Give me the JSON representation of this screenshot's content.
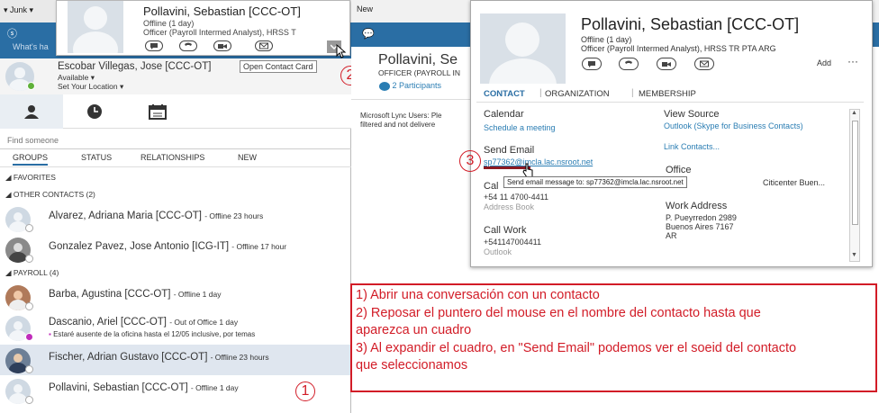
{
  "top_left": {
    "junk_label": "Junk",
    "new_label": "New",
    "whats_label": "What's ha"
  },
  "me": {
    "name": "Escobar Villegas, Jose [CCC-OT]",
    "availability": "Available",
    "location": "Set Your Location",
    "tooltip": "Open Contact Card"
  },
  "search": {
    "placeholder": "Find someone"
  },
  "group_tabs": [
    "GROUPS",
    "STATUS",
    "RELATIONSHIPS",
    "NEW"
  ],
  "sections": {
    "favorites": "FAVORITES",
    "other": "OTHER CONTACTS (2)",
    "payroll": "PAYROLL (4)"
  },
  "contacts": [
    {
      "name": "Alvarez, Adriana Maria [CCC-OT]",
      "status": "- Offline 23 hours"
    },
    {
      "name": "Gonzalez Pavez, Jose Antonio [ICG-IT]",
      "status": "- Offline 17 hour"
    },
    {
      "name": "Barba, Agustina [CCC-OT]",
      "status": "- Offline 1 day"
    },
    {
      "name": "Dascanio, Ariel [CCC-OT]",
      "status": "- Out of Office 1 day",
      "note": "Estaré ausente de la oficina hasta el  12/05  inclusive, por temas"
    },
    {
      "name": "Fischer, Adrian Gustavo [CCC-OT]",
      "status": "- Offline 23 hours"
    },
    {
      "name": "Pollavini, Sebastian [CCC-OT]",
      "status": "- Offline 1 day"
    }
  ],
  "card_small": {
    "name": "Pollavini, Sebastian [CCC-OT]",
    "status": "Offline (1 day)",
    "title": "Officer (Payroll Intermed Analyst), HRSS T"
  },
  "conversation": {
    "name": "Pollavini, Se",
    "title": "OFFICER (PAYROLL IN",
    "participants": "2 Participants",
    "message1": "Microsoft Lync Users: Ple",
    "message2": "filtered and not delivere"
  },
  "card_big": {
    "name": "Pollavini, Sebastian [CCC-OT]",
    "status": "Offline (1 day)",
    "title": "Officer (Payroll Intermed Analyst), HRSS TR PTA ARG",
    "add_label": "Add",
    "tabs": [
      "CONTACT",
      "ORGANIZATION",
      "MEMBERSHIP"
    ],
    "calendar_label": "Calendar",
    "schedule_link": "Schedule a meeting",
    "view_source_label": "View Source",
    "view_source_value": "Outlook (Skype for Business Contacts)",
    "link_contacts": "Link Contacts...",
    "send_email_label": "Send Email",
    "email": "sp77362@imcla.lac.nsroot.net",
    "email_tooltip": "Send email message to: sp77362@imcla.lac.nsroot.net",
    "office_label": "Office",
    "office_value": "Citicenter Buen...",
    "call_label": "Cal",
    "call_number": "+54 11 4700-4411",
    "call_source": "Address Book",
    "work_address_label": "Work Address",
    "work_address_lines": [
      "P. Pueyrredon 2989",
      "Buenos Aires 7167",
      "AR"
    ],
    "call_work_label": "Call Work",
    "call_work_number": "+541147004411",
    "call_work_source": "Outlook"
  },
  "instructions": [
    "1) Abrir una conversación con un contacto",
    "2) Reposar el puntero del mouse en el nombre del contacto hasta que",
    "aparezca un cuadro",
    "3) Al expandir el cuadro, en \"Send Email\" podemos ver el soeid del contacto",
    "que seleccionamos"
  ],
  "markers": [
    "1",
    "2",
    "3"
  ],
  "colors": {
    "lync_blue": "#2a6ea4",
    "annotation_red": "#d21c27",
    "link": "#2a7db3",
    "available_green": "#5fb13a"
  }
}
